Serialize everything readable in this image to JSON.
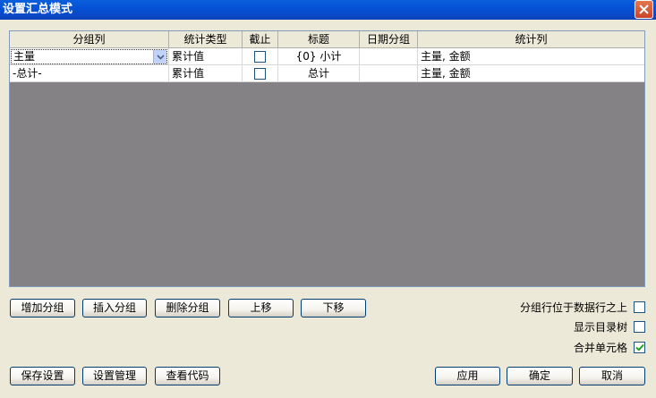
{
  "window": {
    "title": "设置汇总模式"
  },
  "grid": {
    "columns": [
      "分组列",
      "统计类型",
      "截止",
      "标题",
      "日期分组",
      "统计列"
    ],
    "rows": [
      {
        "group": "主量",
        "stat_type": "累计值",
        "cutoff": false,
        "title": "{0} 小计",
        "date_group": "",
        "stat_columns": "主量, 金额"
      },
      {
        "group": "-总计-",
        "stat_type": "累计值",
        "cutoff": false,
        "title": "总计",
        "date_group": "",
        "stat_columns": "主量, 金额"
      }
    ]
  },
  "buttons": {
    "add_group": "增加分组",
    "insert_group": "插入分组",
    "delete_group": "删除分组",
    "move_up": "上移",
    "move_down": "下移",
    "save_settings": "保存设置",
    "settings_manage": "设置管理",
    "view_code": "查看代码",
    "apply": "应用",
    "ok": "确定",
    "cancel": "取消"
  },
  "options": [
    {
      "label": "分组行位于数据行之上",
      "checked": false
    },
    {
      "label": "显示目录树",
      "checked": false
    },
    {
      "label": "合并单元格",
      "checked": true
    }
  ],
  "icons": {
    "close": "close-icon",
    "dropdown": "chevron-down-icon",
    "check": "checkmark-icon"
  },
  "colors": {
    "titlebar": "#0552d6",
    "dialog_bg": "#ece9d8",
    "grid_empty_bg": "#858285"
  }
}
